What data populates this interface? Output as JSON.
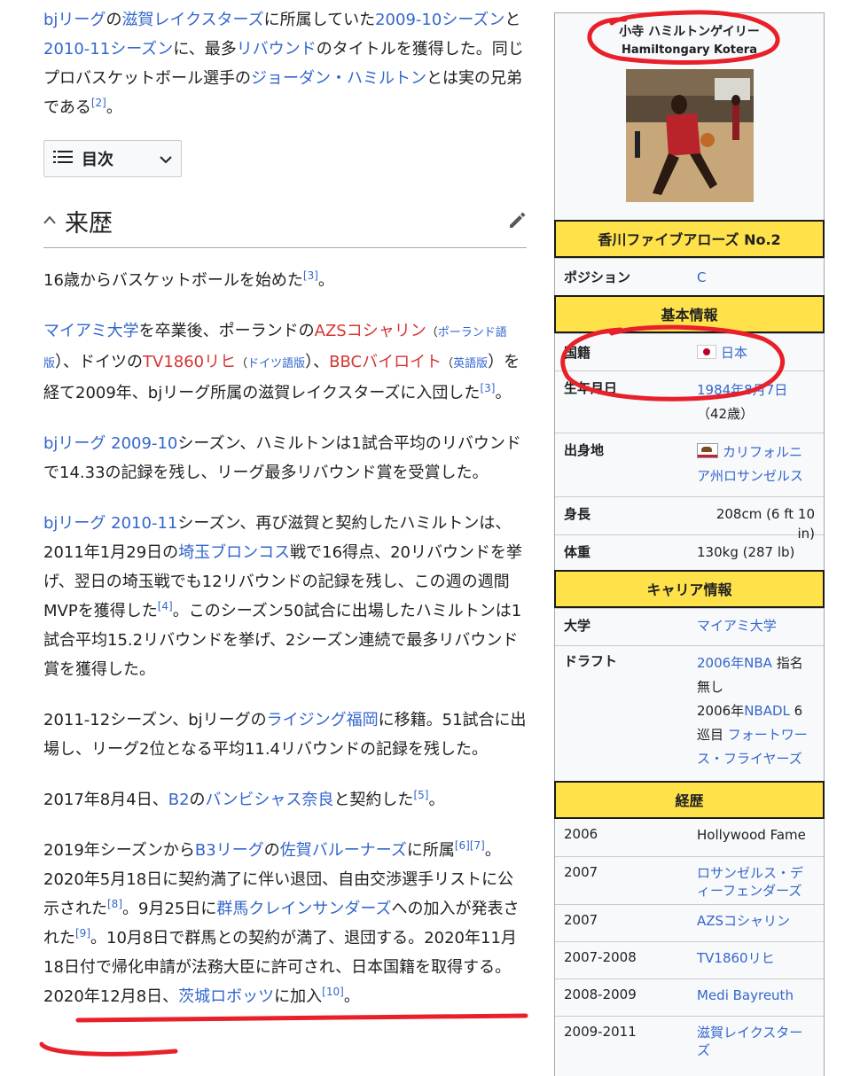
{
  "article": {
    "intro": {
      "league": "bjリーグ",
      "p1": "の",
      "team": "滋賀レイクスターズ",
      "p2": "に所属していた",
      "season1": "2009-10シーズン",
      "p3": "と",
      "season2": "2010-11シーズン",
      "p4": "に、最多",
      "rebound": "リバウンド",
      "p5": "のタイトルを獲得した。同じプロバスケットボール選手の",
      "brother": "ジョーダン・ハミルトン",
      "p6": "とは実の兄弟である",
      "ref2": "[2]",
      "p7": "。"
    },
    "toc_label": "目次",
    "section_title": "来歴",
    "para1": {
      "text": "16歳からバスケットボールを始めた",
      "ref": "[3]",
      "end": "。"
    },
    "para2": {
      "miami": "マイアミ大学",
      "t1": "を卒業後、ポーランドの",
      "azs": "AZSコシャリン",
      "poland_open": "（",
      "poland_link": "ポーランド語版",
      "t2": "）、ドイツの",
      "tv1860": "TV1860リヒ",
      "de_open": "（",
      "de_link": "ドイツ語版",
      "t3": "）、",
      "bbc": "BBCバイロイト",
      "en_open": "（",
      "en_link": "英語版",
      "t4": "）を経て2009年、bjリーグ所属の滋賀レイクスターズに入団した",
      "ref": "[3]",
      "end": "。"
    },
    "para3": {
      "link": "bjリーグ 2009-10",
      "text": "シーズン、ハミルトンは1試合平均のリバウンドで14.33の記録を残し、リーグ最多リバウンド賞を受賞した。"
    },
    "para4": {
      "link": "bjリーグ 2010-11",
      "t1": "シーズン、再び滋賀と契約したハミルトンは、2011年1月29日の",
      "saitama": "埼玉ブロンコス",
      "t2": "戦で16得点、20リバウンドを挙げ、翌日の埼玉戦でも12リバウンドの記録を残し、この週の週間MVPを獲得した",
      "ref": "[4]",
      "t3": "。このシーズン50試合に出場したハミルトンは1試合平均15.2リバウンドを挙げ、2シーズン連続で最多リバウンド賞を獲得した。"
    },
    "para5": {
      "t1": "2011-12シーズン、bjリーグの",
      "link": "ライジング福岡",
      "t2": "に移籍。51試合に出場し、リーグ2位となる平均11.4リバウンドの記録を残した。"
    },
    "para6": {
      "t1": "2017年8月4日、",
      "b2": "B2",
      "t2": "の",
      "nara": "バンビシャス奈良",
      "t3": "と契約した",
      "ref": "[5]",
      "end": "。"
    },
    "para7": {
      "t1": "2019年シーズンから",
      "b3": "B3リーグ",
      "t2": "の",
      "saga": "佐賀バルーナーズ",
      "t3": "に所属",
      "ref6": "[6]",
      "ref7": "[7]",
      "t4": "。2020年5月18日に契約満了に伴い退団、自由交渉選手リストに公示された",
      "ref8": "[8]",
      "t5": "。9月25日に",
      "gunma": "群馬クレインサンダーズ",
      "t6": "への加入が発表された",
      "ref9": "[9]",
      "t7": "。10月8日で群馬との契約が満了、退団する。",
      "highlight": "2020年11月18日付で帰化申請が法務大臣に許可され、日本国籍を取得する。",
      "t8": "2020年12月8日、",
      "ibaraki": "茨城ロボッツ",
      "t9": "に加入",
      "ref10": "[10]",
      "end": "。"
    }
  },
  "infobox": {
    "name": "小寺 ハミルトンゲイリー",
    "romanized": "Hamiltongary Kotera",
    "team_header": "香川ファイブアローズ  No.2",
    "position": {
      "key": "ポジション",
      "value": "C"
    },
    "basic_header": "基本情報",
    "nationality": {
      "key": "国籍",
      "value": "日本"
    },
    "birth": {
      "key": "生年月日",
      "value": "1984年8月7日",
      "age": "（42歳）"
    },
    "birthplace": {
      "key": "出身地",
      "value": "カリフォルニア州ロサンゼルス"
    },
    "height": {
      "key": "身長",
      "value": "208cm (6 ft 10 in)"
    },
    "weight": {
      "key": "体重",
      "value": "130kg (287 lb)"
    },
    "career_header": "キャリア情報",
    "college": {
      "key": "大学",
      "value": "マイアミ大学"
    },
    "draft": {
      "key": "ドラフト",
      "l1": "2006年NBA",
      "t1": " 指名無し",
      "t2": "2006年",
      "l2": "NBADL",
      "t3": " 6巡目 ",
      "l3": "フォートワース・フライヤーズ"
    },
    "history_header": "経歴",
    "history": [
      {
        "year": "2006",
        "team": "Hollywood Fame",
        "link": false
      },
      {
        "year": "2007",
        "team": "ロサンゼルス・ディーフェンダーズ",
        "link": true
      },
      {
        "year": "2007",
        "team": "AZSコシャリン",
        "link": true
      },
      {
        "year": "2007-2008",
        "team": "TV1860リヒ",
        "link": true
      },
      {
        "year": "2008-2009",
        "team": "Medi Bayreuth",
        "link": true
      },
      {
        "year": "2009-2011",
        "team": "滋賀レイクスターズ",
        "link": true
      }
    ]
  },
  "colors": {
    "link": "#3366cc",
    "redlink": "#d73333",
    "header_bg": "#ffe14a",
    "annotation": "#e8202a"
  }
}
